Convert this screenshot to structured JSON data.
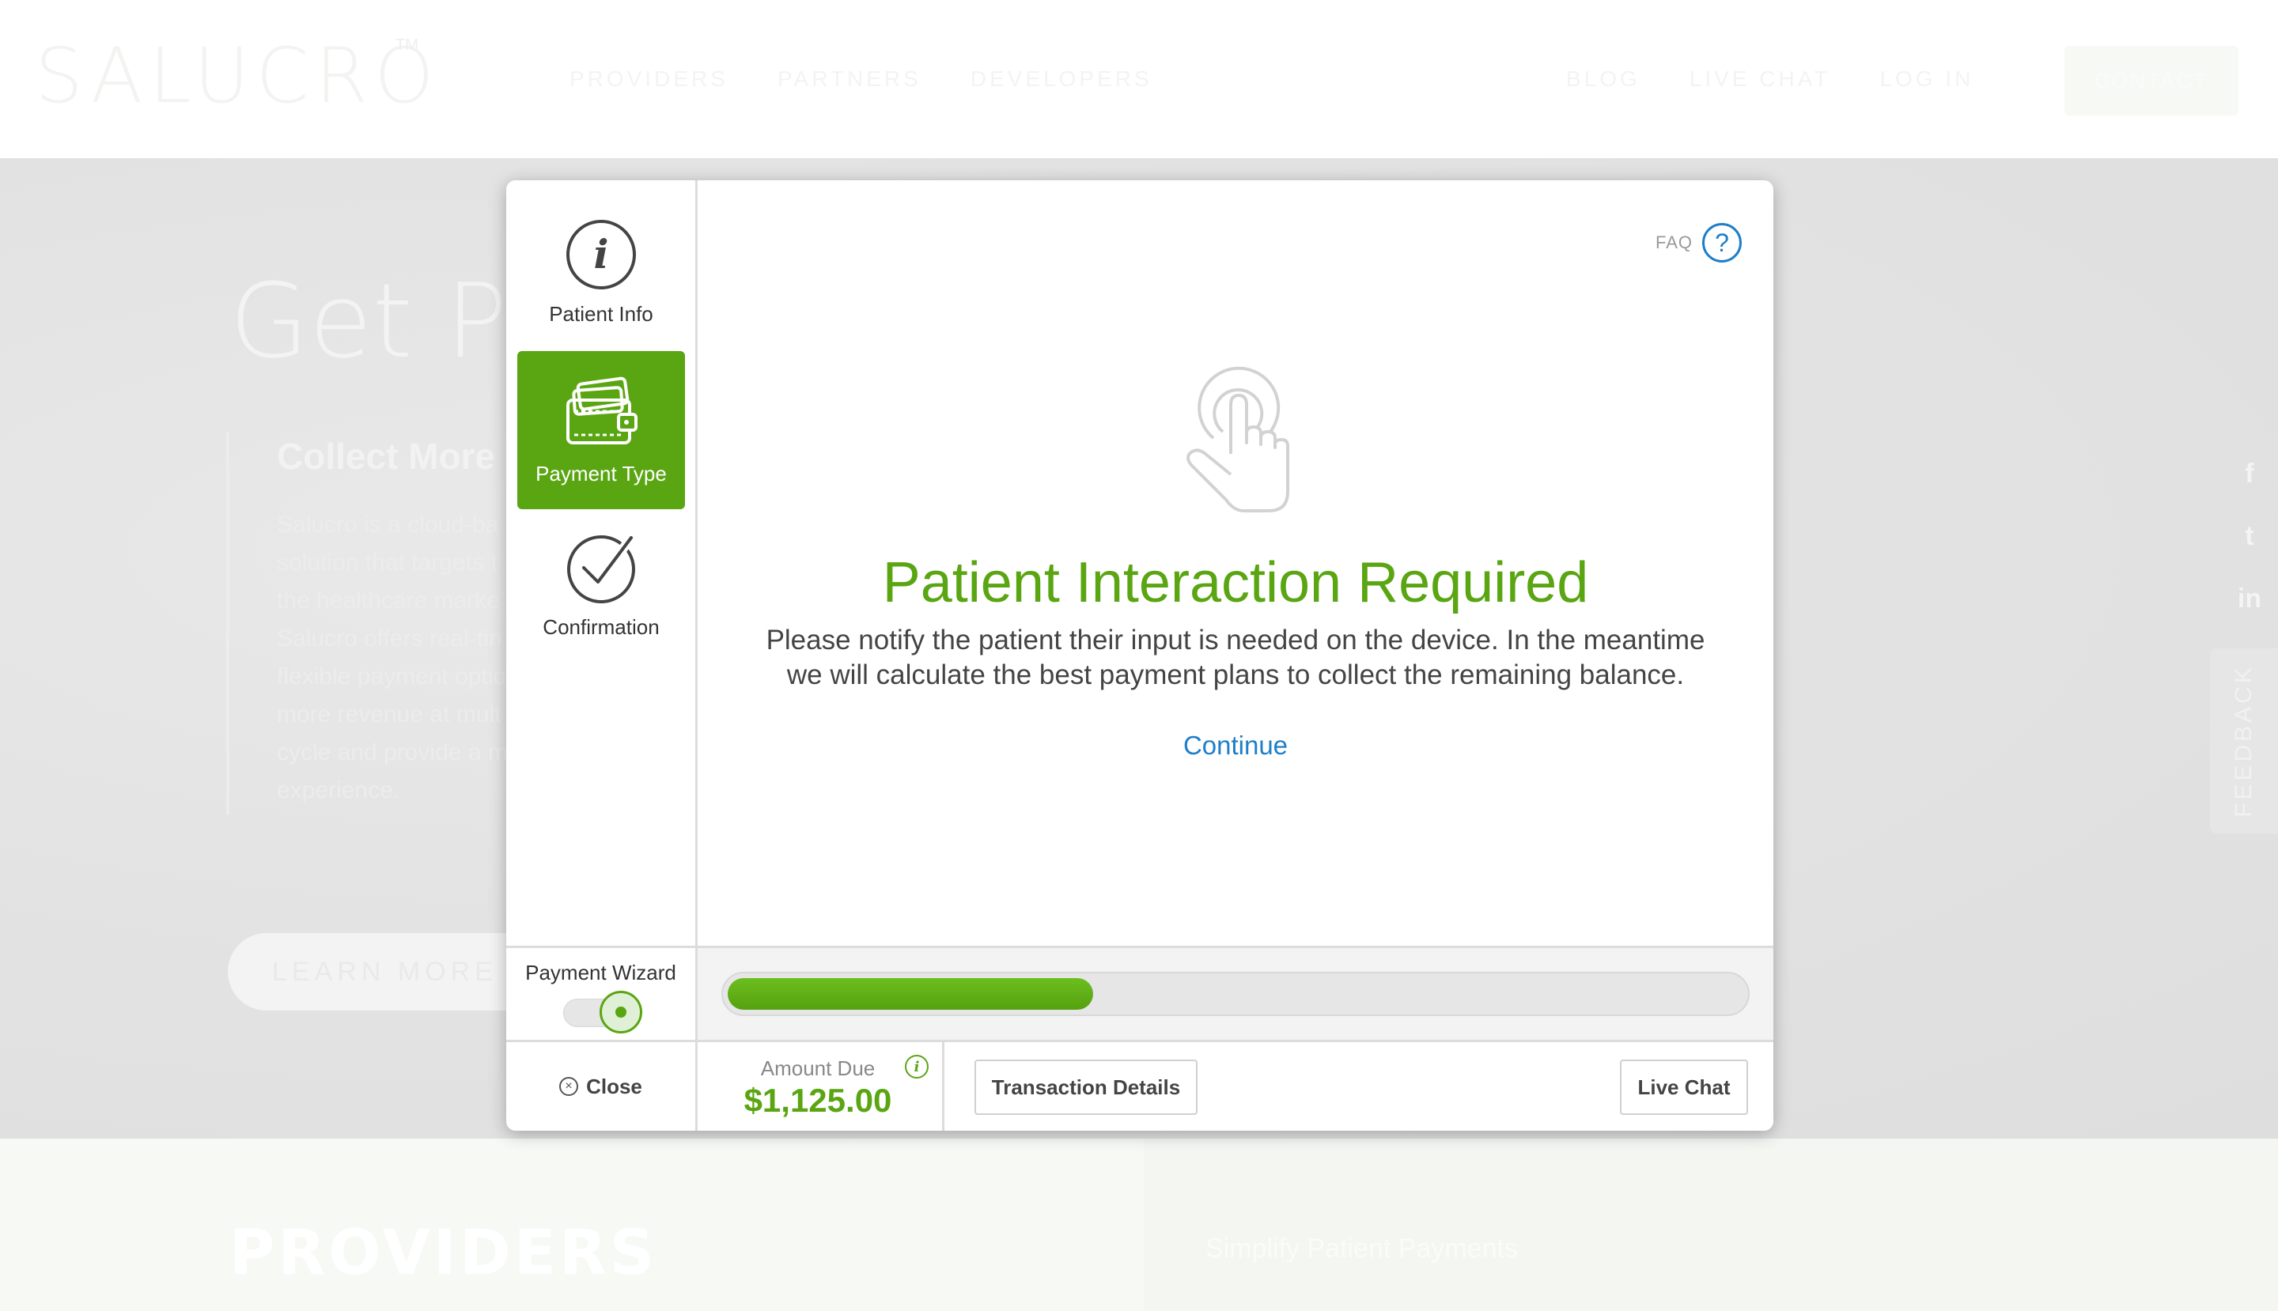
{
  "site": {
    "logo": "SALUCRO",
    "logo_tm": "TM",
    "nav_left": [
      "PROVIDERS",
      "PARTNERS",
      "DEVELOPERS"
    ],
    "nav_right": [
      "BLOG",
      "LIVE CHAT",
      "LOG IN"
    ],
    "contact_label": "CONTACT",
    "hero_title": "Get Pa",
    "hero_subtitle": "Collect More",
    "hero_text_lines": [
      "Salucro is a cloud-ba",
      "solution that targets t",
      "the healthcare marke",
      "Salucro offers real-tin",
      "flexible payment optio",
      "more revenue at mult",
      "cycle and provide a m",
      "experience."
    ],
    "learn_more_label": "LEARN MORE",
    "social_icons": [
      "f",
      "t",
      "in"
    ],
    "feedback_label": "FEEDBACK",
    "providers_title": "PROVIDERS",
    "providers_subtitle": "Simplify Patient Payments"
  },
  "modal": {
    "steps": [
      {
        "label": "Patient Info",
        "icon": "info-icon",
        "active": false
      },
      {
        "label": "Payment Type",
        "icon": "wallet-icon",
        "active": true
      },
      {
        "label": "Confirmation",
        "icon": "checkmark-icon",
        "active": false
      }
    ],
    "faq_label": "FAQ",
    "faq_icon": "?",
    "title": "Patient Interaction Required",
    "message_line1": "Please notify the patient their input is needed on the device. In the meantime",
    "message_line2": "we will calculate the best payment plans to collect the remaining balance.",
    "continue_label": "Continue",
    "wizard_label": "Payment Wizard",
    "wizard_enabled": true,
    "progress_fraction": 0.36,
    "close_label": "Close",
    "amount_due_label": "Amount Due",
    "amount_due_value": "$1,125.00",
    "transaction_details_label": "Transaction Details",
    "live_chat_label": "Live Chat",
    "accent_color": "#5aa512",
    "link_color": "#1e7ec8"
  }
}
